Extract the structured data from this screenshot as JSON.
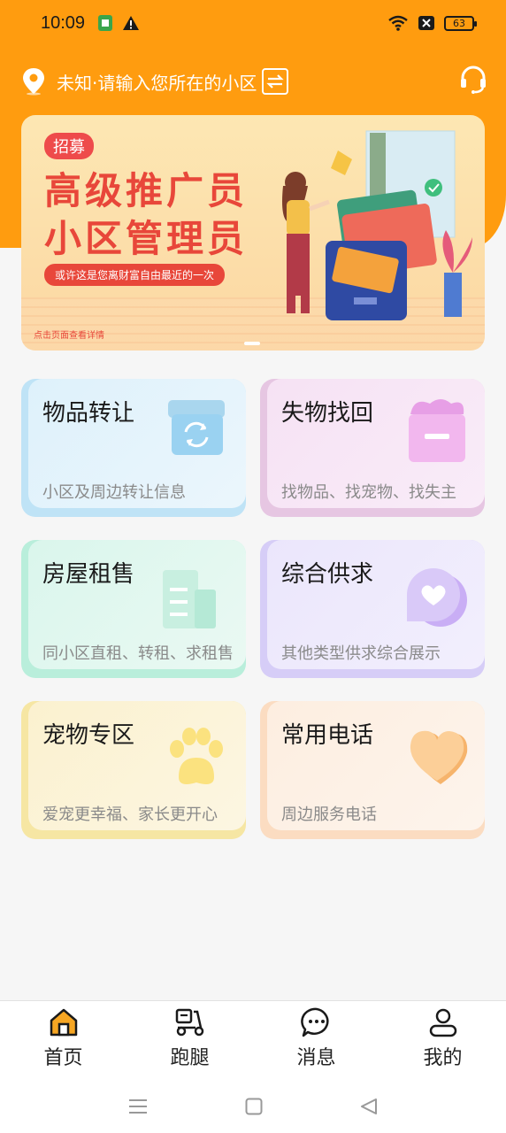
{
  "status_bar": {
    "time": "10:09",
    "battery": "63"
  },
  "location": {
    "prefix": "未知",
    "separator": "·",
    "placeholder": "请输入您所在的小区"
  },
  "banner": {
    "badge": "招募",
    "title_line1": "高级推广员",
    "title_line2": "小区管理员",
    "subtitle": "或许这是您离财富自由最近的一次",
    "hint": "点击页面查看详情"
  },
  "cards": [
    {
      "title": "物品转让",
      "subtitle": "小区及周边转让信息",
      "icon": "transfer-box-icon"
    },
    {
      "title": "失物找回",
      "subtitle": "找物品、找宠物、找失主",
      "icon": "lost-found-box-icon"
    },
    {
      "title": "房屋租售",
      "subtitle": "同小区直租、转租、求租售",
      "icon": "building-icon"
    },
    {
      "title": "综合供求",
      "subtitle": "其他类型供求综合展示",
      "icon": "heart-bubble-icon"
    },
    {
      "title": "宠物专区",
      "subtitle": "爱宠更幸福、家长更开心",
      "icon": "paw-icon"
    },
    {
      "title": "常用电话",
      "subtitle": "周边服务电话",
      "icon": "heart-icon"
    }
  ],
  "nav": [
    {
      "label": "首页",
      "icon": "home-icon",
      "active": true
    },
    {
      "label": "跑腿",
      "icon": "scooter-icon"
    },
    {
      "label": "消息",
      "icon": "message-icon"
    },
    {
      "label": "我的",
      "icon": "user-icon"
    }
  ],
  "colors": {
    "brand": "#ff9c0f",
    "banner_red": "#e8473a"
  }
}
